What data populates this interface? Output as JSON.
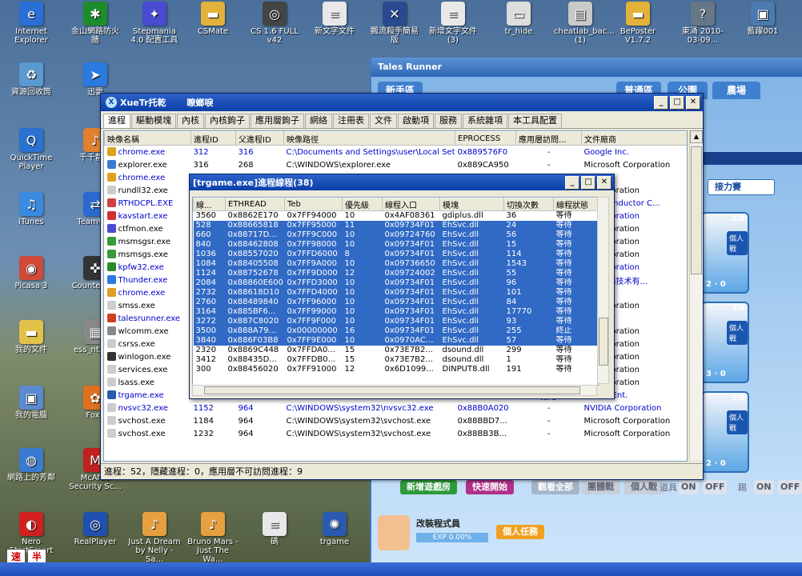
{
  "desktop_icons": [
    {
      "label": "Internet Explorer",
      "color": "#2a6fd6",
      "glyph": "e"
    },
    {
      "label": "金山網路防火牆",
      "color": "#1d8c2d",
      "glyph": "✱"
    },
    {
      "label": "Stepmania 4.0 配置工具",
      "color": "#4a4ad0",
      "glyph": "✦"
    },
    {
      "label": "CSMate",
      "color": "#e2b23a",
      "glyph": "▬"
    },
    {
      "label": "CS 1.6 FULL v42",
      "color": "#444444",
      "glyph": "◎"
    },
    {
      "label": "新文字文件",
      "color": "#e8e8e8",
      "glyph": "≡"
    },
    {
      "label": "飄流殺手簡易版",
      "color": "#2a4a90",
      "glyph": "✕"
    },
    {
      "label": "新增文字文件 (3)",
      "color": "#e8e8e8",
      "glyph": "≡"
    },
    {
      "label": "tr_hide",
      "color": "#dddddd",
      "glyph": "▭"
    },
    {
      "label": "cheatlab_bac... (1)",
      "color": "#c9c9c9",
      "glyph": "▤"
    },
    {
      "label": "BePoster V1.7.2",
      "color": "#e2b23a",
      "glyph": "▬"
    },
    {
      "label": "東涌 2010-03-09...",
      "color": "#667788",
      "glyph": "?"
    },
    {
      "label": "藍躍001",
      "color": "#4a7ab0",
      "glyph": "▣"
    },
    {
      "label": "資源回收筒",
      "color": "#5a9ad0",
      "glyph": "♻"
    },
    {
      "label": "迅雷",
      "color": "#2a7ae0",
      "glyph": "➤"
    },
    {
      "label": "QuickTime Player",
      "color": "#2a72d0",
      "glyph": "Q"
    },
    {
      "label": "千千靜聽",
      "color": "#e08030",
      "glyph": "♪"
    },
    {
      "label": "iTunes",
      "color": "#3a8ae0",
      "glyph": "♫"
    },
    {
      "label": "TeamVi...",
      "color": "#2a6ad0",
      "glyph": "⇄"
    },
    {
      "label": "Picasa 3",
      "color": "#d04a3a",
      "glyph": "◉"
    },
    {
      "label": "Counter-S...",
      "color": "#333333",
      "glyph": "✜"
    },
    {
      "label": "我的文件",
      "color": "#e2c24a",
      "glyph": "▬"
    },
    {
      "label": "ess_nt32...",
      "color": "#888888",
      "glyph": "▦"
    },
    {
      "label": "我的電腦",
      "color": "#5a8ad0",
      "glyph": "▣"
    },
    {
      "label": "Foxy",
      "color": "#e07020",
      "glyph": "✿"
    },
    {
      "label": "網路上的芳鄰",
      "color": "#3a7ad0",
      "glyph": "◍"
    },
    {
      "label": "McAfee Security Sc...",
      "color": "#c02020",
      "glyph": "M"
    },
    {
      "label": "Nero StartSmart",
      "color": "#d02020",
      "glyph": "◐"
    },
    {
      "label": "RealPlayer",
      "color": "#2050b0",
      "glyph": "◎"
    },
    {
      "label": "Just A Dream by Nelly - Sa...",
      "color": "#e6a040",
      "glyph": "♪"
    },
    {
      "label": "Bruno Mars - Just The Wa...",
      "color": "#e6a040",
      "glyph": "♪"
    },
    {
      "label": "碼",
      "color": "#e8e8e8",
      "glyph": "≡"
    },
    {
      "label": "trgame",
      "color": "#2a5ab0",
      "glyph": "✺"
    }
  ],
  "game": {
    "title": "Tales Runner",
    "tabs": [
      "新手區",
      "普通區",
      "公園",
      "農場"
    ],
    "relay_button": "接力賽",
    "rooms": [
      {
        "badge": "2/2",
        "solo": "個人戰",
        "count_a": "2",
        "count_b": "0"
      },
      {
        "badge": "3/8",
        "solo": "個人戰",
        "count_a": "3",
        "count_b": "0"
      },
      {
        "badge": "2/8",
        "solo": "個人戰",
        "count_a": "2",
        "count_b": "0"
      }
    ],
    "create_room": "新增遊戲房",
    "quick_start": "快速開始",
    "watch_all": "觀看全部",
    "group_battle": "團體戰",
    "solo_battle": "個人戰",
    "item_label": "道具",
    "kick_label": "踢",
    "on_label": "ON",
    "off_label": "OFF",
    "player_name": "改裝程式員",
    "exp": "EXP 0.00%",
    "personal_mission": "個人任務",
    "scroll_text": "入 • 頻道獎勵 經驗值+"
  },
  "xuetr": {
    "title": "XueTr托乾　　 瞭螂唳",
    "tabs": [
      "進程",
      "驅動模塊",
      "內核",
      "內核鉤子",
      "應用層鉤子",
      "網絡",
      "注冊表",
      "文件",
      "啟動項",
      "服務",
      "系統雜項",
      "本工具配置"
    ],
    "columns": [
      "映像名稱",
      "進程ID",
      "父進程ID",
      "映像路徑",
      "EPROCESS",
      "應用層訪問...",
      "文件廠商"
    ],
    "rows": [
      {
        "name": "chrome.exe",
        "pid": "312",
        "ppid": "316",
        "path": "C:\\Documents and Settings\\user\\Local Sett...",
        "eprocess": "0x889576F0",
        "access": "-",
        "vendor": "Google Inc.",
        "ms": false,
        "icon": "#e0a020"
      },
      {
        "name": "explorer.exe",
        "pid": "316",
        "ppid": "268",
        "path": "C:\\WINDOWS\\explorer.exe",
        "eprocess": "0x889CA950",
        "access": "-",
        "vendor": "Microsoft Corporation",
        "ms": true,
        "icon": "#3a7ad0"
      },
      {
        "name": "chrome.exe",
        "pid": "",
        "ppid": "",
        "path": "",
        "eprocess": "",
        "access": "",
        "vendor": "Inc.",
        "ms": false,
        "icon": "#e0a020"
      },
      {
        "name": "rundll32.exe",
        "pid": "",
        "ppid": "",
        "path": "",
        "eprocess": "",
        "access": "",
        "vendor": "ft Corporation",
        "ms": true,
        "icon": "#cccccc"
      },
      {
        "name": "RTHDCPL.EXE",
        "pid": "",
        "ppid": "",
        "path": "",
        "eprocess": "",
        "access": "",
        "vendor": "Semiconductor C...",
        "ms": false,
        "icon": "#d04040"
      },
      {
        "name": "kavstart.exe",
        "pid": "",
        "ppid": "",
        "path": "",
        "eprocess": "",
        "access": "",
        "vendor": "ft Corporation",
        "ms": false,
        "icon": "#d03030"
      },
      {
        "name": "ctfmon.exe",
        "pid": "",
        "ppid": "",
        "path": "",
        "eprocess": "",
        "access": "",
        "vendor": "ft Corporation",
        "ms": true,
        "icon": "#4a4ad0"
      },
      {
        "name": "msmsgsr.exe",
        "pid": "",
        "ppid": "",
        "path": "",
        "eprocess": "",
        "access": "",
        "vendor": "ft Corporation",
        "ms": true,
        "icon": "#3a9a3a"
      },
      {
        "name": "msmsgs.exe",
        "pid": "",
        "ppid": "",
        "path": "",
        "eprocess": "",
        "access": "",
        "vendor": "ft Corporation",
        "ms": true,
        "icon": "#3a9a3a"
      },
      {
        "name": "kpfw32.exe",
        "pid": "",
        "ppid": "",
        "path": "",
        "eprocess": "",
        "access": "",
        "vendor": "ft Corporation",
        "ms": false,
        "icon": "#2a8a2a"
      },
      {
        "name": "Thunder.exe",
        "pid": "",
        "ppid": "",
        "path": "",
        "eprocess": "",
        "access": "",
        "vendor": "迅雷网络技术有...",
        "ms": false,
        "icon": "#2a7ae0"
      },
      {
        "name": "chrome.exe",
        "pid": "",
        "ppid": "",
        "path": "",
        "eprocess": "",
        "access": "",
        "vendor": "Inc.",
        "ms": false,
        "icon": "#e0a020"
      },
      {
        "name": "smss.exe",
        "pid": "",
        "ppid": "",
        "path": "",
        "eprocess": "",
        "access": "",
        "vendor": "ft Corporation",
        "ms": true,
        "icon": "#cccccc"
      },
      {
        "name": "talesrunner.exe",
        "pid": "",
        "ppid": "",
        "path": "",
        "eprocess": "",
        "access": "",
        "vendor": "Ent.",
        "ms": false,
        "icon": "#d04020"
      },
      {
        "name": "wlcomm.exe",
        "pid": "",
        "ppid": "",
        "path": "",
        "eprocess": "",
        "access": "",
        "vendor": "ft Corporation",
        "ms": true,
        "icon": "#888888"
      },
      {
        "name": "csrss.exe",
        "pid": "",
        "ppid": "",
        "path": "",
        "eprocess": "",
        "access": "",
        "vendor": "ft Corporation",
        "ms": true,
        "icon": "#cccccc"
      },
      {
        "name": "winlogon.exe",
        "pid": "",
        "ppid": "",
        "path": "",
        "eprocess": "",
        "access": "",
        "vendor": "ft Corporation",
        "ms": true,
        "icon": "#333333"
      },
      {
        "name": "services.exe",
        "pid": "",
        "ppid": "",
        "path": "",
        "eprocess": "",
        "access": "",
        "vendor": "ft Corporation",
        "ms": true,
        "icon": "#cccccc"
      },
      {
        "name": "lsass.exe",
        "pid": "",
        "ppid": "",
        "path": "",
        "eprocess": "",
        "access": "",
        "vendor": "ft Corporation",
        "ms": true,
        "icon": "#cccccc"
      },
      {
        "name": "trgame.exe",
        "pid": "1072",
        "ppid": "872",
        "path": "C:\\Program Files\\TalesRunner\\trgame.exe",
        "eprocess": "0x88457020",
        "access": "拒絕",
        "vendor": "Rhaon Ent.",
        "ms": false,
        "icon": "#2a5ab0"
      },
      {
        "name": "nvsvc32.exe",
        "pid": "1152",
        "ppid": "964",
        "path": "C:\\WINDOWS\\system32\\nvsvc32.exe",
        "eprocess": "0x88B0A020",
        "access": "-",
        "vendor": "NVIDIA Corporation",
        "ms": false,
        "icon": "#cccccc"
      },
      {
        "name": "svchost.exe",
        "pid": "1184",
        "ppid": "964",
        "path": "C:\\WINDOWS\\system32\\svchost.exe",
        "eprocess": "0x88BBD7...",
        "access": "-",
        "vendor": "Microsoft Corporation",
        "ms": true,
        "icon": "#cccccc"
      },
      {
        "name": "svchost.exe",
        "pid": "1232",
        "ppid": "964",
        "path": "C:\\WINDOWS\\system32\\svchost.exe",
        "eprocess": "0x88BB3B...",
        "access": "-",
        "vendor": "Microsoft Corporation",
        "ms": true,
        "icon": "#cccccc"
      }
    ],
    "status": "進程：52，隱藏進程：0，應用層不可訪問進程：9"
  },
  "threads": {
    "title": "[trgame.exe]進程線程(38)",
    "columns": [
      "線...",
      "ETHREAD",
      "Teb",
      "優先級",
      "線程入口",
      "模塊",
      "切換次數",
      "線程狀態"
    ],
    "rows": [
      {
        "tid": "3560",
        "ethread": "0x8862E170",
        "teb": "0x7FF94000",
        "prio": "10",
        "entry": "0x4AF08361",
        "module": "gdiplus.dll",
        "switches": "36",
        "state": "等待",
        "sel": false
      },
      {
        "tid": "528",
        "ethread": "0x88665818",
        "teb": "0x7FF95000",
        "prio": "11",
        "entry": "0x09734F01",
        "module": "EhSvc.dll",
        "switches": "24",
        "state": "等待",
        "sel": true
      },
      {
        "tid": "660",
        "ethread": "0x88717D...",
        "teb": "0x7FF9C000",
        "prio": "10",
        "entry": "0x09724760",
        "module": "EhSvc.dll",
        "switches": "56",
        "state": "等待",
        "sel": true
      },
      {
        "tid": "840",
        "ethread": "0x88462808",
        "teb": "0x7FF98000",
        "prio": "10",
        "entry": "0x09734F01",
        "module": "EhSvc.dll",
        "switches": "15",
        "state": "等待",
        "sel": true
      },
      {
        "tid": "1036",
        "ethread": "0x88557020",
        "teb": "0x7FFD6000",
        "prio": "8",
        "entry": "0x09734F01",
        "module": "EhSvc.dll",
        "switches": "114",
        "state": "等待",
        "sel": true
      },
      {
        "tid": "1084",
        "ethread": "0x88405508",
        "teb": "0x7FF9A000",
        "prio": "10",
        "entry": "0x09736650",
        "module": "EhSvc.dll",
        "switches": "1543",
        "state": "等待",
        "sel": true
      },
      {
        "tid": "1124",
        "ethread": "0x88752678",
        "teb": "0x7FF9D000",
        "prio": "12",
        "entry": "0x09724002",
        "module": "EhSvc.dll",
        "switches": "55",
        "state": "等待",
        "sel": true
      },
      {
        "tid": "2084",
        "ethread": "0x88860E600",
        "teb": "0x7FFD3000",
        "prio": "10",
        "entry": "0x09734F01",
        "module": "EhSvc.dll",
        "switches": "96",
        "state": "等待",
        "sel": true
      },
      {
        "tid": "2732",
        "ethread": "0x88618D10",
        "teb": "0x7FFD4000",
        "prio": "10",
        "entry": "0x09734F01",
        "module": "EhSvc.dll",
        "switches": "101",
        "state": "等待",
        "sel": true
      },
      {
        "tid": "2760",
        "ethread": "0x88489840",
        "teb": "0x7FF96000",
        "prio": "10",
        "entry": "0x09734F01",
        "module": "EhSvc.dll",
        "switches": "84",
        "state": "等待",
        "sel": true
      },
      {
        "tid": "3164",
        "ethread": "0x885BF6...",
        "teb": "0x7FF99000",
        "prio": "10",
        "entry": "0x09734F01",
        "module": "EhSvc.dll",
        "switches": "17770",
        "state": "等待",
        "sel": true
      },
      {
        "tid": "3272",
        "ethread": "0x887C8020",
        "teb": "0x7FF9F000",
        "prio": "10",
        "entry": "0x09734F01",
        "module": "EhSvc.dll",
        "switches": "93",
        "state": "等待",
        "sel": true
      },
      {
        "tid": "3500",
        "ethread": "0x888A79...",
        "teb": "0x00000000",
        "prio": "16",
        "entry": "0x09734F01",
        "module": "EhSvc.dll",
        "switches": "255",
        "state": "終止",
        "sel": true
      },
      {
        "tid": "3840",
        "ethread": "0x886F03B8",
        "teb": "0x7FF9E000",
        "prio": "10",
        "entry": "0x0970AC...",
        "module": "EhSvc.dll",
        "switches": "57",
        "state": "等待",
        "sel": true
      },
      {
        "tid": "2320",
        "ethread": "0x8869C448",
        "teb": "0x7FFDA0...",
        "prio": "15",
        "entry": "0x73E7B2...",
        "module": "dsound.dll",
        "switches": "299",
        "state": "等待",
        "sel": false
      },
      {
        "tid": "3412",
        "ethread": "0x88435D...",
        "teb": "0x7FFDB0...",
        "prio": "15",
        "entry": "0x73E7B2...",
        "module": "dsound.dll",
        "switches": "1",
        "state": "等待",
        "sel": false
      },
      {
        "tid": "300",
        "ethread": "0x88456020",
        "teb": "0x7FF91000",
        "prio": "12",
        "entry": "0x6D1099...",
        "module": "DINPUT8.dll",
        "switches": "191",
        "state": "等待",
        "sel": false
      }
    ]
  },
  "ime": {
    "a": "速",
    "b": "半"
  }
}
